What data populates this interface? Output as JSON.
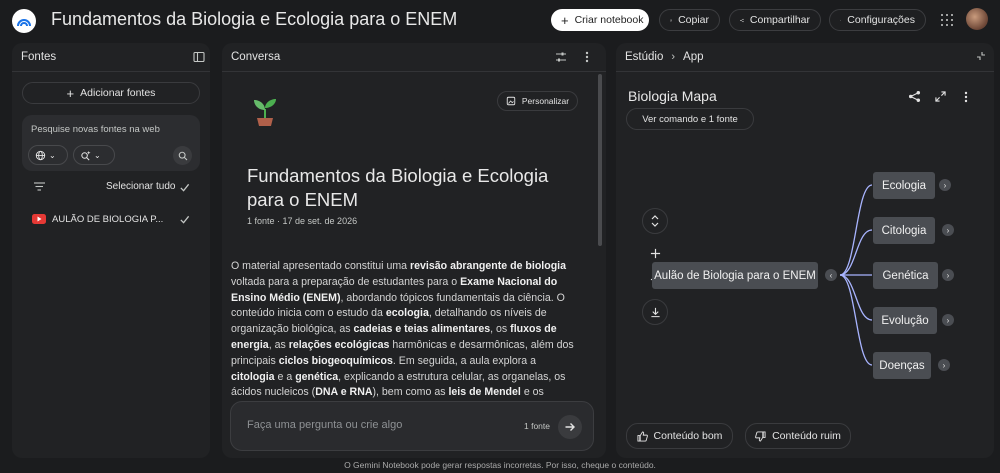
{
  "header": {
    "title": "Fundamentos da Biologia e Ecologia para o ENEM",
    "create_label": "Criar notebook",
    "copy_label": "Copiar",
    "share_label": "Compartilhar",
    "settings_label": "Configurações"
  },
  "sources": {
    "title": "Fontes",
    "add_label": "Adicionar fontes",
    "search_placeholder": "Pesquise novas fontes na web",
    "select_all_label": "Selecionar tudo",
    "items": [
      {
        "label": "AULÃO DE BIOLOGIA P..."
      }
    ]
  },
  "chat": {
    "title": "Conversa",
    "personalize_label": "Personalizar",
    "notebook_title": "Fundamentos da Biologia e Ecologia para o ENEM",
    "meta": "1 fonte · 17 de set. de 2026",
    "input_placeholder": "Faça uma pergunta ou crie algo",
    "source_count": "1 fonte"
  },
  "studio": {
    "breadcrumb_root": "Estúdio",
    "breadcrumb_leaf": "App",
    "title": "Biologia Mapa",
    "command_label": "Ver comando e 1 fonte",
    "map": {
      "root": "Aulão de Biologia para o ENEM",
      "branches": [
        "Ecologia",
        "Citologia",
        "Genética",
        "Evolução",
        "Doenças"
      ]
    },
    "good_label": "Conteúdo bom",
    "bad_label": "Conteúdo ruim"
  },
  "footer": "O Gemini Notebook pode gerar respostas incorretas. Por isso, cheque o conteúdo.",
  "colors": {
    "background": "#1b1c1e",
    "panel": "#212224",
    "node": "#4a4d52",
    "edge": "#a8b4ff",
    "youtube": "#e53935"
  }
}
